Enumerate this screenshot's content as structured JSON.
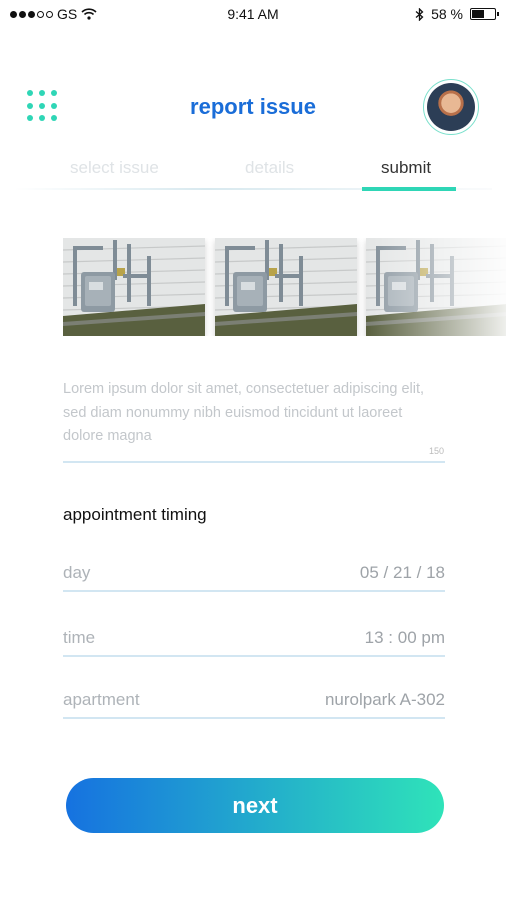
{
  "status_bar": {
    "carrier": "GS",
    "time": "9:41 AM",
    "battery": "58 %",
    "battery_level": 0.58
  },
  "header": {
    "title": "report issue",
    "menu_icon": "grid-dots-icon",
    "avatar": "user-avatar"
  },
  "tabs": [
    {
      "label": "select issue",
      "active": false
    },
    {
      "label": "details",
      "active": false
    },
    {
      "label": "submit",
      "active": true
    }
  ],
  "photos": [
    "gas-meter-photo",
    "gas-meter-photo",
    "gas-meter-photo"
  ],
  "description": {
    "text": "Lorem ipsum dolor sit amet, consectetuer adipiscing elit, sed diam nonummy nibh euismod tincidunt ut laoreet dolore magna",
    "counter": "150"
  },
  "appointment": {
    "section_label": "appointment timing",
    "day": {
      "label": "day",
      "value": "05 / 21 / 18"
    },
    "time": {
      "label": "time",
      "value": "13 : 00 pm"
    },
    "apartment": {
      "label": "apartment",
      "value": "nurolpark A-302"
    }
  },
  "next_button": {
    "label": "next"
  },
  "colors": {
    "accent": "#2fd6b6",
    "title_blue": "#1a6dd8",
    "button_start": "#1672e0",
    "button_end": "#2fe3b9"
  }
}
